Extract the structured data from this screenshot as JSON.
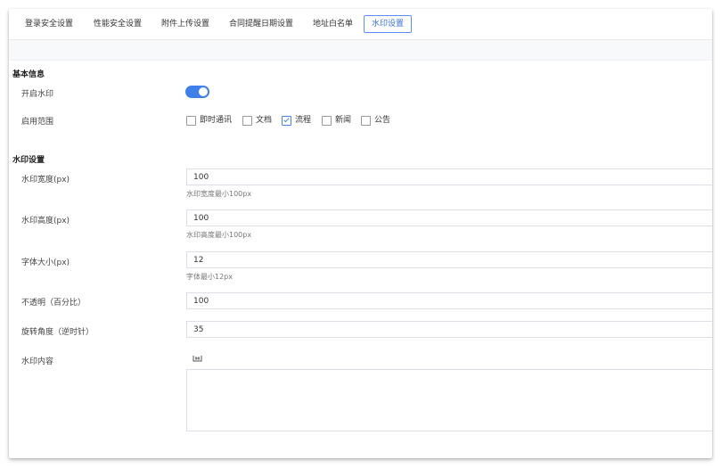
{
  "tabs": [
    {
      "label": "登录安全设置"
    },
    {
      "label": "性能安全设置"
    },
    {
      "label": "附件上传设置"
    },
    {
      "label": "合同提醒日期设置"
    },
    {
      "label": "地址白名单"
    },
    {
      "label": "水印设置"
    }
  ],
  "active_tab": "水印设置",
  "basic": {
    "title": "基本信息",
    "enable_label": "开启水印",
    "enable_value": true,
    "scope_label": "启用范围",
    "scope_options": [
      {
        "label": "即时通讯",
        "checked": false
      },
      {
        "label": "文档",
        "checked": false
      },
      {
        "label": "流程",
        "checked": true
      },
      {
        "label": "新闻",
        "checked": false
      },
      {
        "label": "公告",
        "checked": false
      }
    ]
  },
  "watermark": {
    "title": "水印设置",
    "width_label": "水印宽度(px)",
    "width_value": "100",
    "width_hint": "水印宽度最小100px",
    "height_label": "水印高度(px)",
    "height_value": "100",
    "height_hint": "水印高度最小100px",
    "font_label": "字体大小(px)",
    "font_value": "12",
    "font_hint": "字体最小12px",
    "opacity_label": "不透明（百分比）",
    "opacity_value": "100",
    "rotate_label": "旋转角度（逆时针）",
    "rotate_value": "35",
    "content_label": "水印内容",
    "content_value": ""
  },
  "colors": {
    "accent": "#3f7fe9"
  }
}
